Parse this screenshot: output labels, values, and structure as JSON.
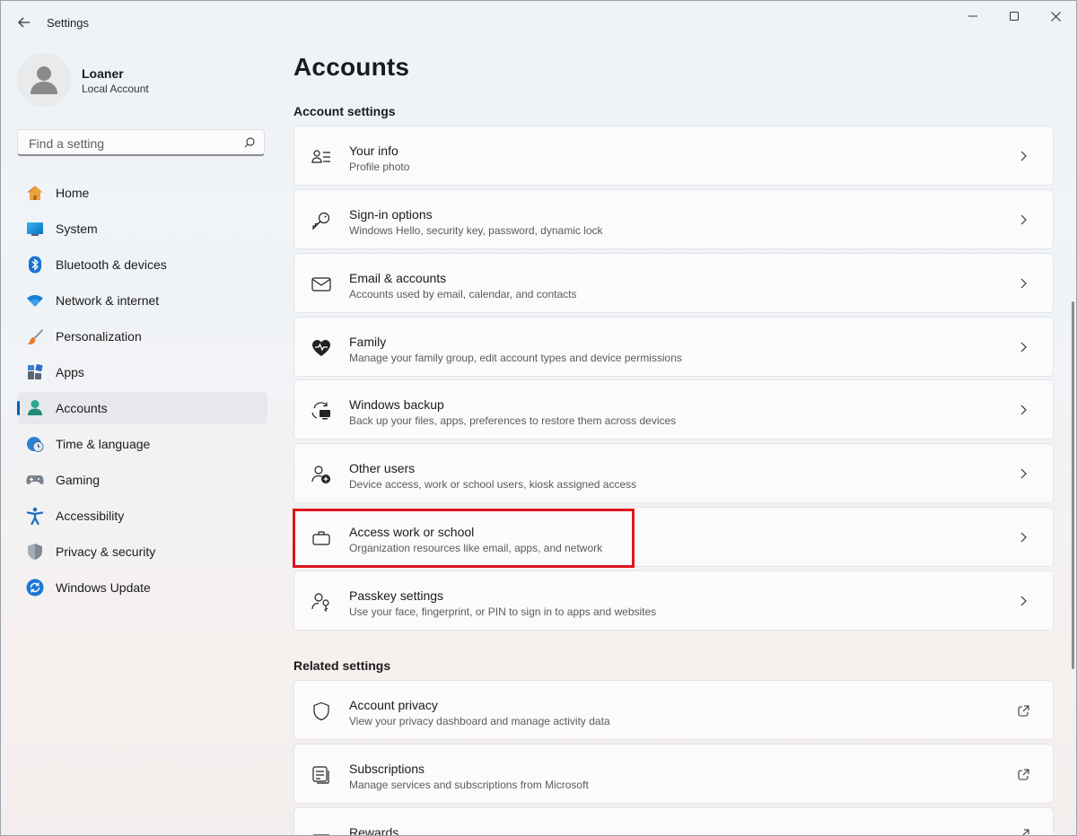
{
  "window": {
    "title": "Settings"
  },
  "user": {
    "name": "Loaner",
    "account_type": "Local Account"
  },
  "search": {
    "placeholder": "Find a setting"
  },
  "nav": [
    {
      "label": "Home",
      "icon": "home-icon"
    },
    {
      "label": "System",
      "icon": "system-icon"
    },
    {
      "label": "Bluetooth & devices",
      "icon": "bluetooth-icon"
    },
    {
      "label": "Network & internet",
      "icon": "wifi-icon"
    },
    {
      "label": "Personalization",
      "icon": "brush-icon"
    },
    {
      "label": "Apps",
      "icon": "apps-icon"
    },
    {
      "label": "Accounts",
      "icon": "accounts-icon",
      "active": true
    },
    {
      "label": "Time & language",
      "icon": "clock-globe-icon"
    },
    {
      "label": "Gaming",
      "icon": "gamepad-icon"
    },
    {
      "label": "Accessibility",
      "icon": "accessibility-icon"
    },
    {
      "label": "Privacy & security",
      "icon": "shield-icon"
    },
    {
      "label": "Windows Update",
      "icon": "update-icon"
    }
  ],
  "page": {
    "title": "Accounts"
  },
  "account_settings": {
    "heading": "Account settings",
    "items": [
      {
        "title": "Your info",
        "subtitle": "Profile photo",
        "icon": "person-info-icon"
      },
      {
        "title": "Sign-in options",
        "subtitle": "Windows Hello, security key, password, dynamic lock",
        "icon": "key-icon"
      },
      {
        "title": "Email & accounts",
        "subtitle": "Accounts used by email, calendar, and contacts",
        "icon": "mail-icon"
      },
      {
        "title": "Family",
        "subtitle": "Manage your family group, edit account types and device permissions",
        "icon": "family-heart-icon"
      },
      {
        "title": "Windows backup",
        "subtitle": "Back up your files, apps, preferences to restore them across devices",
        "icon": "backup-icon"
      },
      {
        "title": "Other users",
        "subtitle": "Device access, work or school users, kiosk assigned access",
        "icon": "add-person-icon"
      },
      {
        "title": "Access work or school",
        "subtitle": "Organization resources like email, apps, and network",
        "icon": "briefcase-icon",
        "highlighted": true
      },
      {
        "title": "Passkey settings",
        "subtitle": "Use your face, fingerprint, or PIN to sign in to apps and websites",
        "icon": "passkey-icon"
      }
    ]
  },
  "related_settings": {
    "heading": "Related settings",
    "items": [
      {
        "title": "Account privacy",
        "subtitle": "View your privacy dashboard and manage activity data",
        "icon": "shield-outline-icon"
      },
      {
        "title": "Subscriptions",
        "subtitle": "Manage services and subscriptions from Microsoft",
        "icon": "subscriptions-icon"
      },
      {
        "title": "Rewards",
        "subtitle": "",
        "icon": "rewards-gift-icon"
      }
    ]
  },
  "colors": {
    "accent": "#005fb8",
    "highlight_border": "#e0141e"
  }
}
